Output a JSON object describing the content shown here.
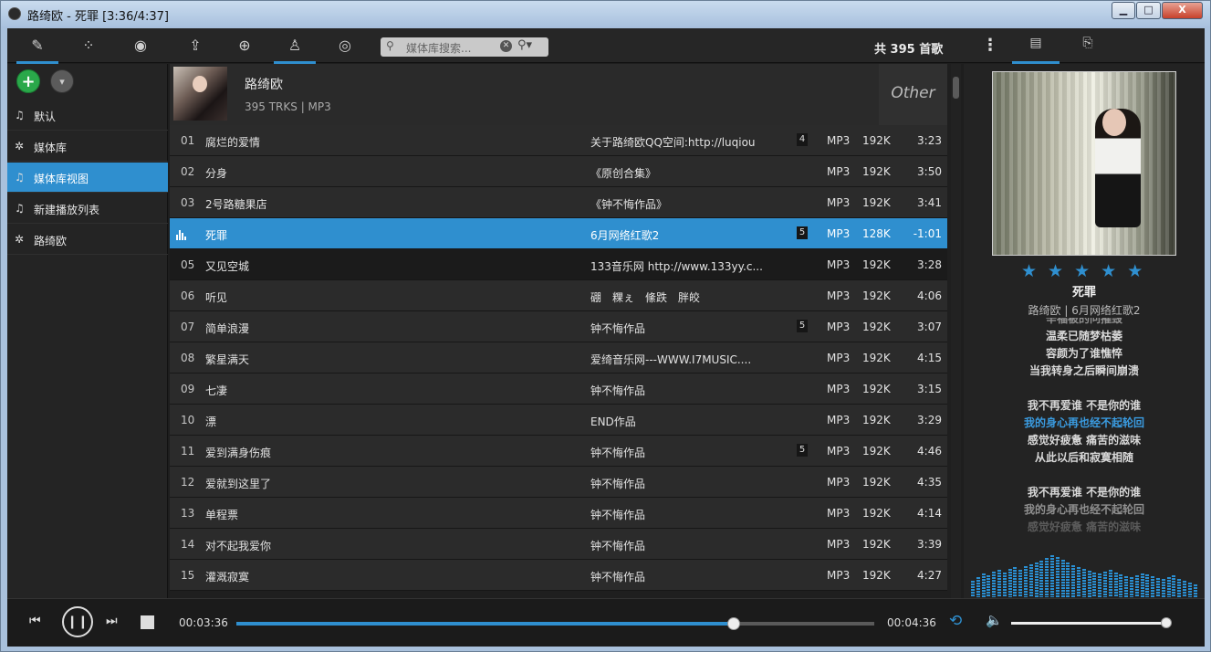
{
  "window": {
    "title": "路绮欧 - 死罪 [3:36/4:37]",
    "min_label": "▁",
    "max_label": "□",
    "close_label": "X"
  },
  "toolbar": {
    "icons": [
      "edit-list-icon",
      "grid-icon",
      "user-circle-icon",
      "share-icon",
      "add-circle-icon",
      "person-icon",
      "disc-icon"
    ],
    "search_placeholder": "媒体库搜索...",
    "count": "共 395 首歌",
    "right_tabs": [
      "album-info-icon",
      "lyrics-tab-icon"
    ]
  },
  "sidebar": {
    "items": [
      {
        "label": "默认",
        "icon": "♫"
      },
      {
        "label": "媒体库",
        "icon": "✲"
      },
      {
        "label": "媒体库视图",
        "icon": "♫"
      },
      {
        "label": "新建播放列表",
        "icon": "♫"
      },
      {
        "label": "路绮欧",
        "icon": "✲"
      }
    ]
  },
  "album": {
    "artist": "路绮欧",
    "subtitle": "395 TRKS | MP3",
    "genre": "Other"
  },
  "tracks": [
    {
      "no": "01",
      "title": "腐烂的爱情",
      "album": "关于路绮欧QQ空间:http://luqiou",
      "badge": "4",
      "format": "MP3",
      "bitrate": "192K",
      "duration": "3:23"
    },
    {
      "no": "02",
      "title": "分身",
      "album": "《原创合集》",
      "badge": "",
      "format": "MP3",
      "bitrate": "192K",
      "duration": "3:50"
    },
    {
      "no": "03",
      "title": "2号路糖果店",
      "album": "《钟不悔作品》",
      "badge": "",
      "format": "MP3",
      "bitrate": "192K",
      "duration": "3:41"
    },
    {
      "no": "",
      "title": "死罪",
      "album": "6月网络红歌2",
      "badge": "5",
      "format": "MP3",
      "bitrate": "128K",
      "duration": "-1:01"
    },
    {
      "no": "05",
      "title": "又见空城",
      "album": "133音乐网 http://www.133yy.c...",
      "badge": "",
      "format": "MP3",
      "bitrate": "192K",
      "duration": "3:28"
    },
    {
      "no": "06",
      "title": "听见",
      "album": "硼　粿ぇ　絛跌　胖皎",
      "badge": "",
      "format": "MP3",
      "bitrate": "192K",
      "duration": "4:06"
    },
    {
      "no": "07",
      "title": "简单浪漫",
      "album": "钟不悔作品",
      "badge": "5",
      "format": "MP3",
      "bitrate": "192K",
      "duration": "3:07"
    },
    {
      "no": "08",
      "title": "繁星满天",
      "album": "爱绮音乐网---WWW.I7MUSIC....",
      "badge": "",
      "format": "MP3",
      "bitrate": "192K",
      "duration": "4:15"
    },
    {
      "no": "09",
      "title": "七凄",
      "album": "钟不悔作品",
      "badge": "",
      "format": "MP3",
      "bitrate": "192K",
      "duration": "3:15"
    },
    {
      "no": "10",
      "title": "漂",
      "album": "END作品",
      "badge": "",
      "format": "MP3",
      "bitrate": "192K",
      "duration": "3:29"
    },
    {
      "no": "11",
      "title": "爱到满身伤痕",
      "album": "钟不悔作品",
      "badge": "5",
      "format": "MP3",
      "bitrate": "192K",
      "duration": "4:46"
    },
    {
      "no": "12",
      "title": "爱就到这里了",
      "album": "钟不悔作品",
      "badge": "",
      "format": "MP3",
      "bitrate": "192K",
      "duration": "4:35"
    },
    {
      "no": "13",
      "title": "单程票",
      "album": "钟不悔作品",
      "badge": "",
      "format": "MP3",
      "bitrate": "192K",
      "duration": "4:14"
    },
    {
      "no": "14",
      "title": "对不起我爱你",
      "album": "钟不悔作品",
      "badge": "",
      "format": "MP3",
      "bitrate": "192K",
      "duration": "3:39"
    },
    {
      "no": "15",
      "title": "灌溉寂寞",
      "album": "钟不悔作品",
      "badge": "",
      "format": "MP3",
      "bitrate": "192K",
      "duration": "4:27"
    }
  ],
  "now_playing": {
    "title": "死罪",
    "subtitle": "路绮欧 | 6月网络红歌2",
    "rating": 5,
    "lyrics": [
      "辛福被的问摧毁",
      "温柔已随梦枯萎",
      "容颜为了谁憔悴",
      "当我转身之后瞬间崩溃",
      "",
      "我不再爱谁 不是你的谁",
      "我的身心再也经不起轮回",
      "感觉好疲惫 痛苦的滋味",
      "从此以后和寂寞相随",
      "",
      "我不再爱谁 不是你的谁",
      "我的身心再也经不起轮回",
      "感觉好疲惫 痛苦的滋味"
    ],
    "highlight_line": 6
  },
  "player": {
    "current_time": "00:03:36",
    "total_time": "00:04:36",
    "progress": 0.78,
    "volume": 0.99
  },
  "colors": {
    "accent": "#2f8fcf",
    "add_green": "#2aa84a"
  }
}
